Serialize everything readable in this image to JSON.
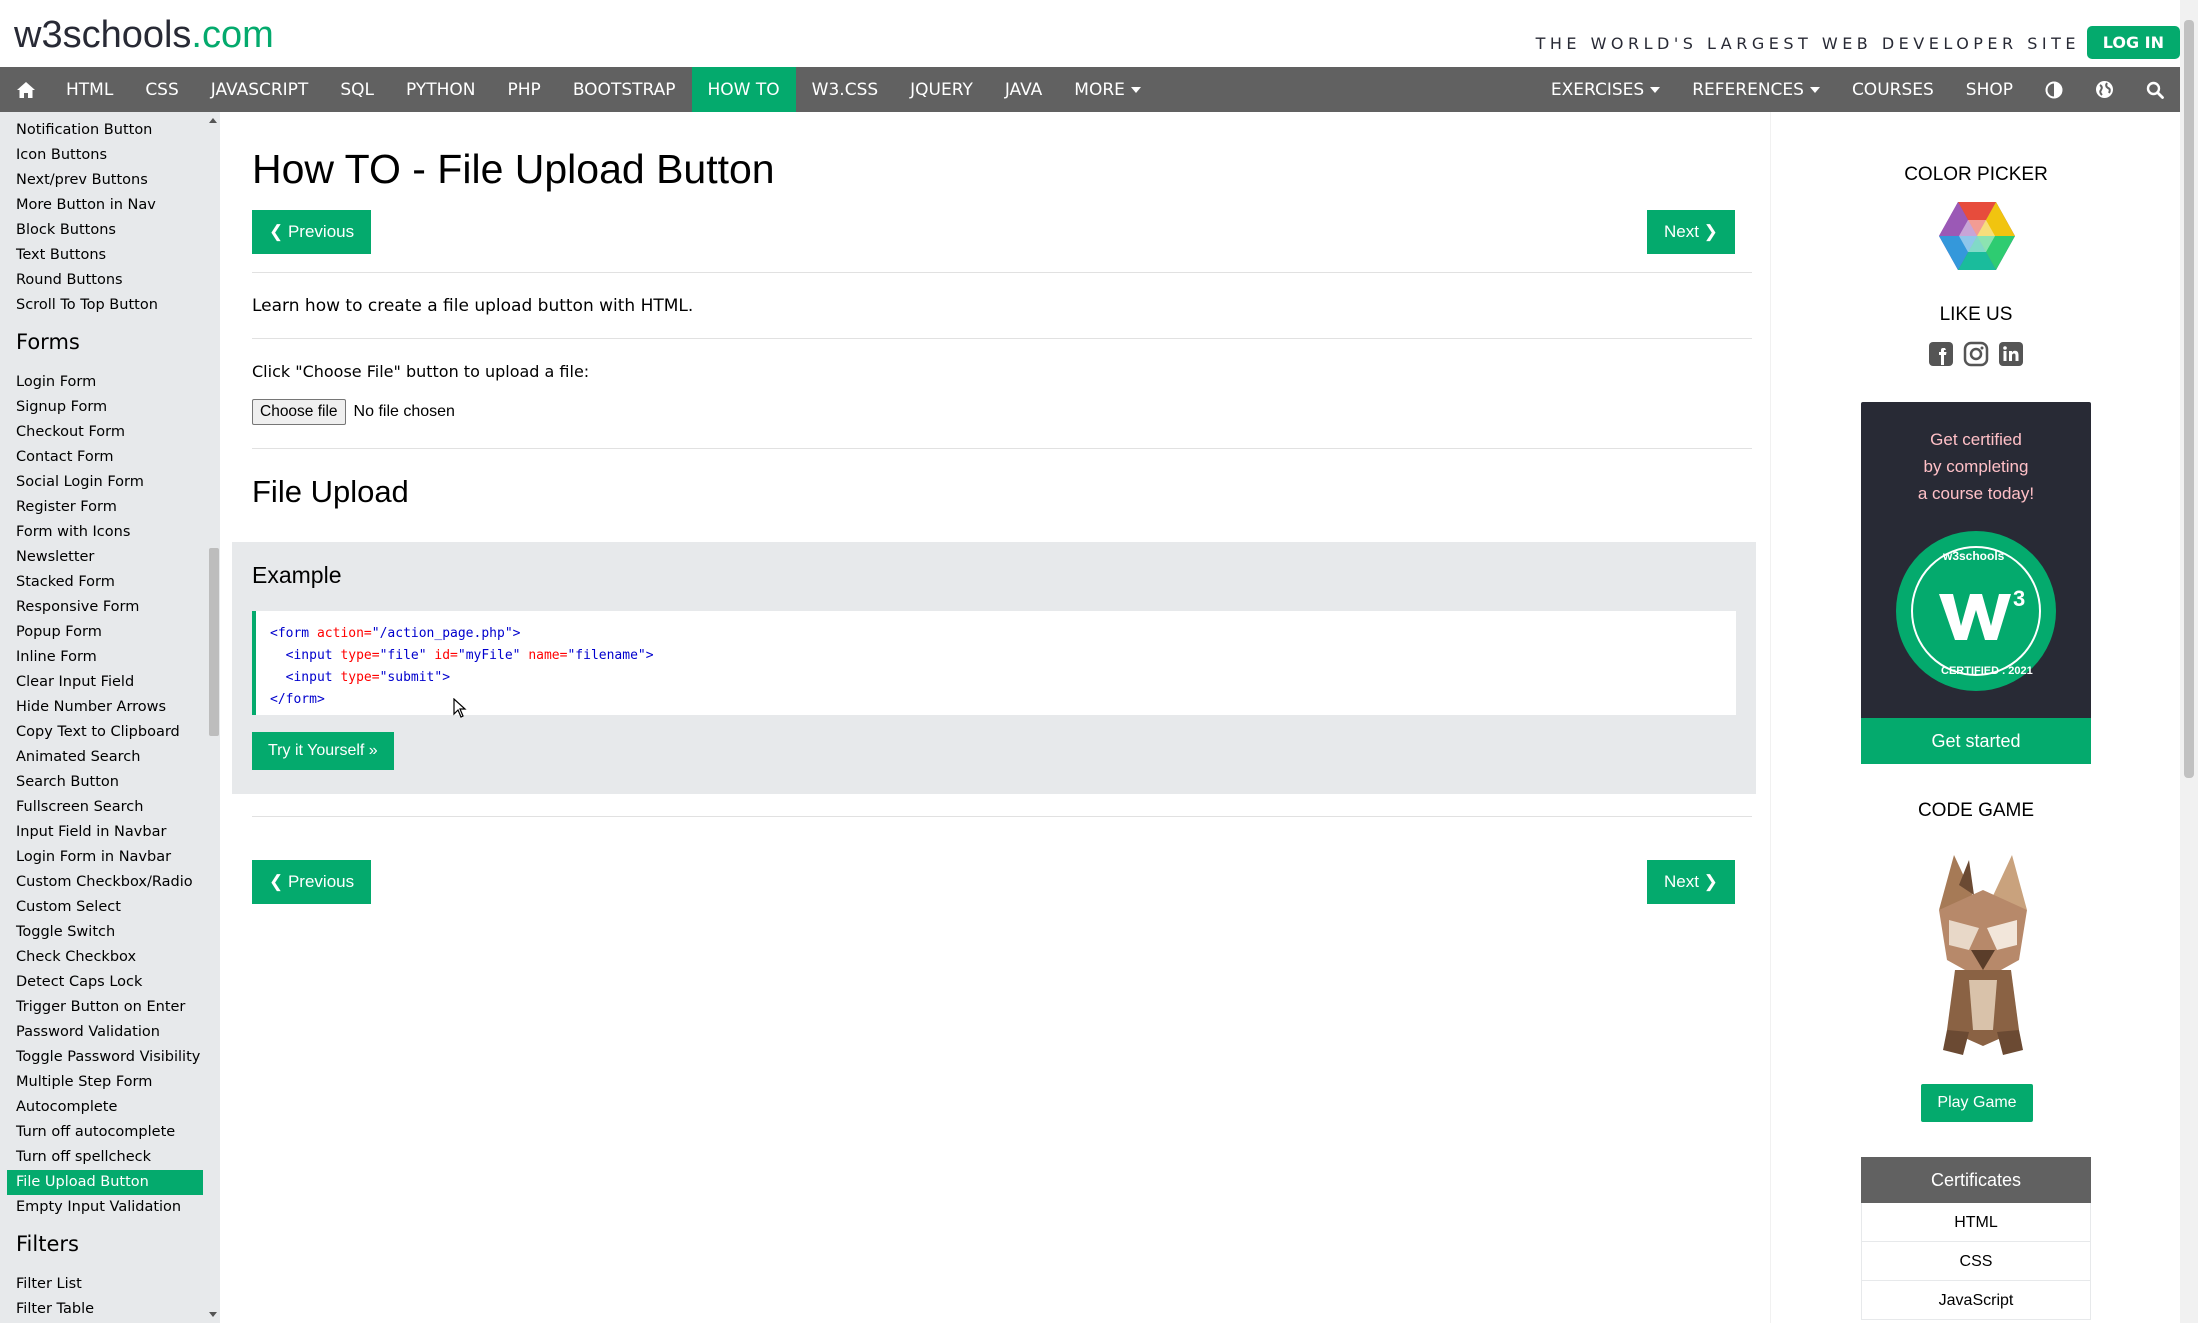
{
  "header": {
    "logo_main": "w3schools",
    "logo_tld": ".com",
    "tagline": "THE WORLD'S LARGEST WEB DEVELOPER SITE",
    "login_label": "LOG IN"
  },
  "nav": {
    "items": [
      "HTML",
      "CSS",
      "JAVASCRIPT",
      "SQL",
      "PYTHON",
      "PHP",
      "BOOTSTRAP",
      "HOW TO",
      "W3.CSS",
      "JQUERY",
      "JAVA",
      "MORE"
    ],
    "active": "HOW TO",
    "right_items": [
      "EXERCISES",
      "REFERENCES",
      "COURSES",
      "SHOP"
    ]
  },
  "sidebar": {
    "top_links": [
      "Notification Button",
      "Icon Buttons",
      "Next/prev Buttons",
      "More Button in Nav",
      "Block Buttons",
      "Text Buttons",
      "Round Buttons",
      "Scroll To Top Button"
    ],
    "forms_heading": "Forms",
    "form_links": [
      "Login Form",
      "Signup Form",
      "Checkout Form",
      "Contact Form",
      "Social Login Form",
      "Register Form",
      "Form with Icons",
      "Newsletter",
      "Stacked Form",
      "Responsive Form",
      "Popup Form",
      "Inline Form",
      "Clear Input Field",
      "Hide Number Arrows",
      "Copy Text to Clipboard",
      "Animated Search",
      "Search Button",
      "Fullscreen Search",
      "Input Field in Navbar",
      "Login Form in Navbar",
      "Custom Checkbox/Radio",
      "Custom Select",
      "Toggle Switch",
      "Check Checkbox",
      "Detect Caps Lock",
      "Trigger Button on Enter",
      "Password Validation",
      "Toggle Password Visibility",
      "Multiple Step Form",
      "Autocomplete",
      "Turn off autocomplete",
      "Turn off spellcheck",
      "File Upload Button",
      "Empty Input Validation"
    ],
    "active": "File Upload Button",
    "filters_heading": "Filters",
    "filter_links": [
      "Filter List",
      "Filter Table"
    ]
  },
  "main": {
    "title": "How TO - File Upload Button",
    "previous_label": "❮ Previous",
    "next_label": "Next ❯",
    "intro": "Learn how to create a file upload button with HTML.",
    "instruction": "Click \"Choose File\" button to upload a file:",
    "choose_file_label": "Choose file",
    "no_file_text": "No file chosen",
    "section_heading": "File Upload",
    "example_heading": "Example",
    "code": {
      "l1_tag_open": "<form",
      "l1_attr": "action=",
      "l1_val": "\"/action_page.php\"",
      "l1_tag_close": ">",
      "l2_tag_open": "<input",
      "l2_attr1": "type=",
      "l2_val1": "\"file\"",
      "l2_attr2": "id=",
      "l2_val2": "\"myFile\"",
      "l2_attr3": "name=",
      "l2_val3": "\"filename\"",
      "l2_tag_close": ">",
      "l3_tag_open": "<input",
      "l3_attr": "type=",
      "l3_val": "\"submit\"",
      "l3_tag_close": ">",
      "l4": "</form>"
    },
    "try_label": "Try it Yourself »"
  },
  "right": {
    "color_picker_label": "COLOR PICKER",
    "like_us_label": "LIKE US",
    "cert_text_1": "Get certified",
    "cert_text_2": "by completing",
    "cert_text_3": "a course today!",
    "badge_top": "w3schools",
    "badge_bottom": "CERTIFIED . 2021",
    "get_started_label": "Get started",
    "code_game_label": "CODE GAME",
    "play_game_label": "Play Game",
    "certificates_label": "Certificates",
    "cert_rows": [
      "HTML",
      "CSS",
      "JavaScript"
    ]
  },
  "colors": {
    "brand_green": "#04AA6D",
    "nav_gray": "#616161",
    "sidebar_bg": "#E7E9EB",
    "dark_card": "#282A35"
  }
}
